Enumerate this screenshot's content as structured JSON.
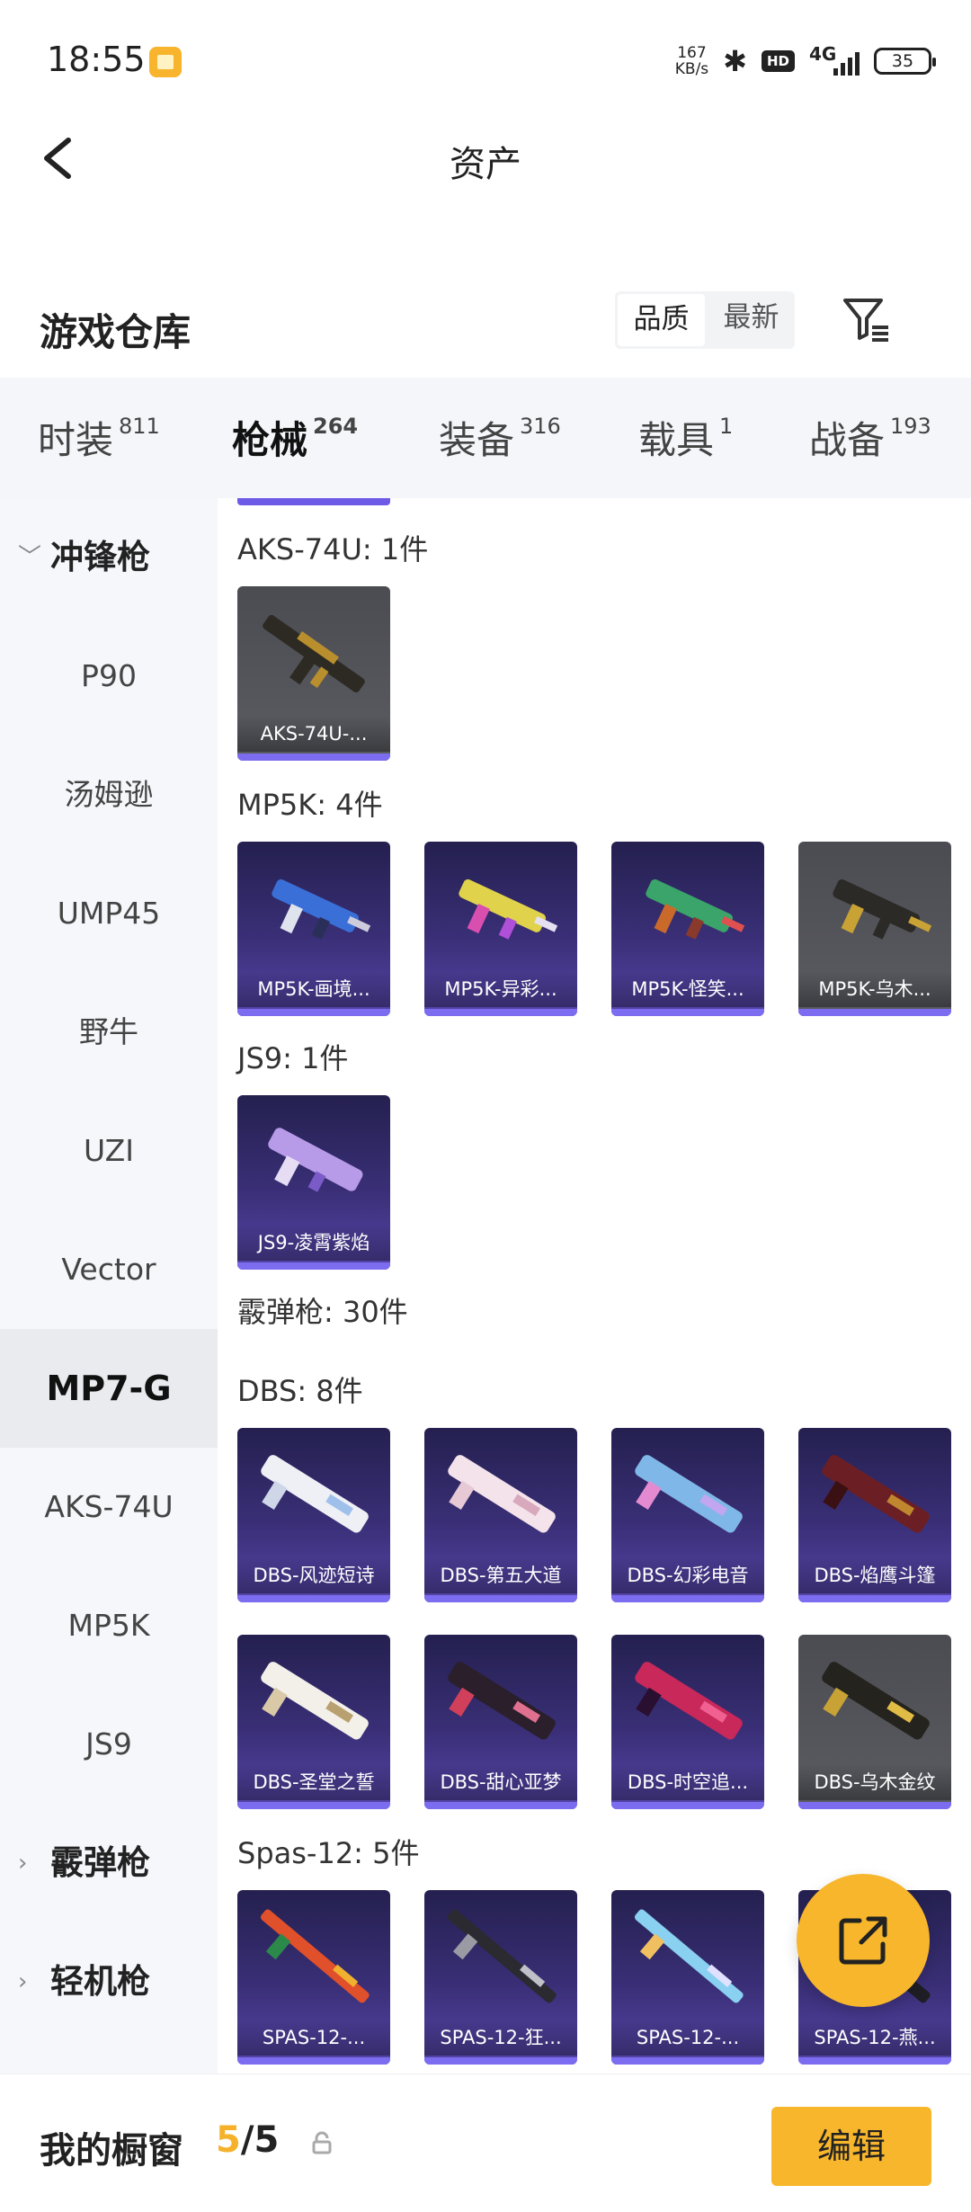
{
  "status_bar": {
    "time": "18:55",
    "net_speed_value": "167",
    "net_speed_unit": "KB/s",
    "hd_label": "HD",
    "network": "4G",
    "battery": "35"
  },
  "header": {
    "title": "资产"
  },
  "section": {
    "title": "游戏仓库",
    "sort_quality": "品质",
    "sort_latest": "最新"
  },
  "tabs": [
    {
      "label": "时装",
      "count": "811"
    },
    {
      "label": "枪械",
      "count": "264"
    },
    {
      "label": "装备",
      "count": "316"
    },
    {
      "label": "载具",
      "count": "1"
    },
    {
      "label": "战备",
      "count": "193"
    }
  ],
  "sidebar": [
    {
      "label": "冲锋枪",
      "type": "group",
      "expanded": true
    },
    {
      "label": "P90"
    },
    {
      "label": "汤姆逊"
    },
    {
      "label": "UMP45"
    },
    {
      "label": "野牛"
    },
    {
      "label": "UZI"
    },
    {
      "label": "Vector"
    },
    {
      "label": "MP7-G",
      "selected": true
    },
    {
      "label": "AKS-74U"
    },
    {
      "label": "MP5K"
    },
    {
      "label": "JS9"
    },
    {
      "label": "霰弹枪",
      "type": "group",
      "expanded": false
    },
    {
      "label": "轻机枪",
      "type": "group",
      "expanded": false
    }
  ],
  "content": {
    "groups": [
      {
        "title": "AKS-74U: 1件",
        "items": [
          {
            "name": "AKS-74U-...",
            "rarity": "gold"
          }
        ]
      },
      {
        "title": "MP5K: 4件",
        "items": [
          {
            "name": "MP5K-画境...",
            "rarity": "purple"
          },
          {
            "name": "MP5K-异彩...",
            "rarity": "purple"
          },
          {
            "name": "MP5K-怪笑...",
            "rarity": "purple"
          },
          {
            "name": "MP5K-乌木...",
            "rarity": "gold"
          }
        ]
      },
      {
        "title": "JS9: 1件",
        "items": [
          {
            "name": "JS9-凌霄紫焰",
            "rarity": "purple"
          }
        ]
      },
      {
        "title": "霰弹枪: 30件",
        "items": []
      },
      {
        "title": "DBS: 8件",
        "items": [
          {
            "name": "DBS-风迹短诗",
            "rarity": "purple"
          },
          {
            "name": "DBS-第五大道",
            "rarity": "purple"
          },
          {
            "name": "DBS-幻彩电音",
            "rarity": "purple"
          },
          {
            "name": "DBS-焰鹰斗篷",
            "rarity": "purple"
          },
          {
            "name": "DBS-圣堂之誓",
            "rarity": "purple"
          },
          {
            "name": "DBS-甜心亚梦",
            "rarity": "purple"
          },
          {
            "name": "DBS-时空追...",
            "rarity": "purple"
          },
          {
            "name": "DBS-乌木金纹",
            "rarity": "gold"
          }
        ]
      },
      {
        "title": "Spas-12: 5件",
        "items": [
          {
            "name": "SPAS-12-...",
            "rarity": "purple"
          },
          {
            "name": "SPAS-12-狂...",
            "rarity": "purple"
          },
          {
            "name": "SPAS-12-...",
            "rarity": "purple"
          },
          {
            "name": "SPAS-12-燕...",
            "rarity": "purple"
          }
        ]
      }
    ]
  },
  "bottom_bar": {
    "title": "我的橱窗",
    "current": "5",
    "separator": "/",
    "total": "5",
    "edit_label": "编辑"
  },
  "colors": {
    "accent": "#f7b62b",
    "rarity_purple": "#3a2f77",
    "rarity_gold": "#55565c",
    "rarity_bar": "#7b6cf0"
  }
}
